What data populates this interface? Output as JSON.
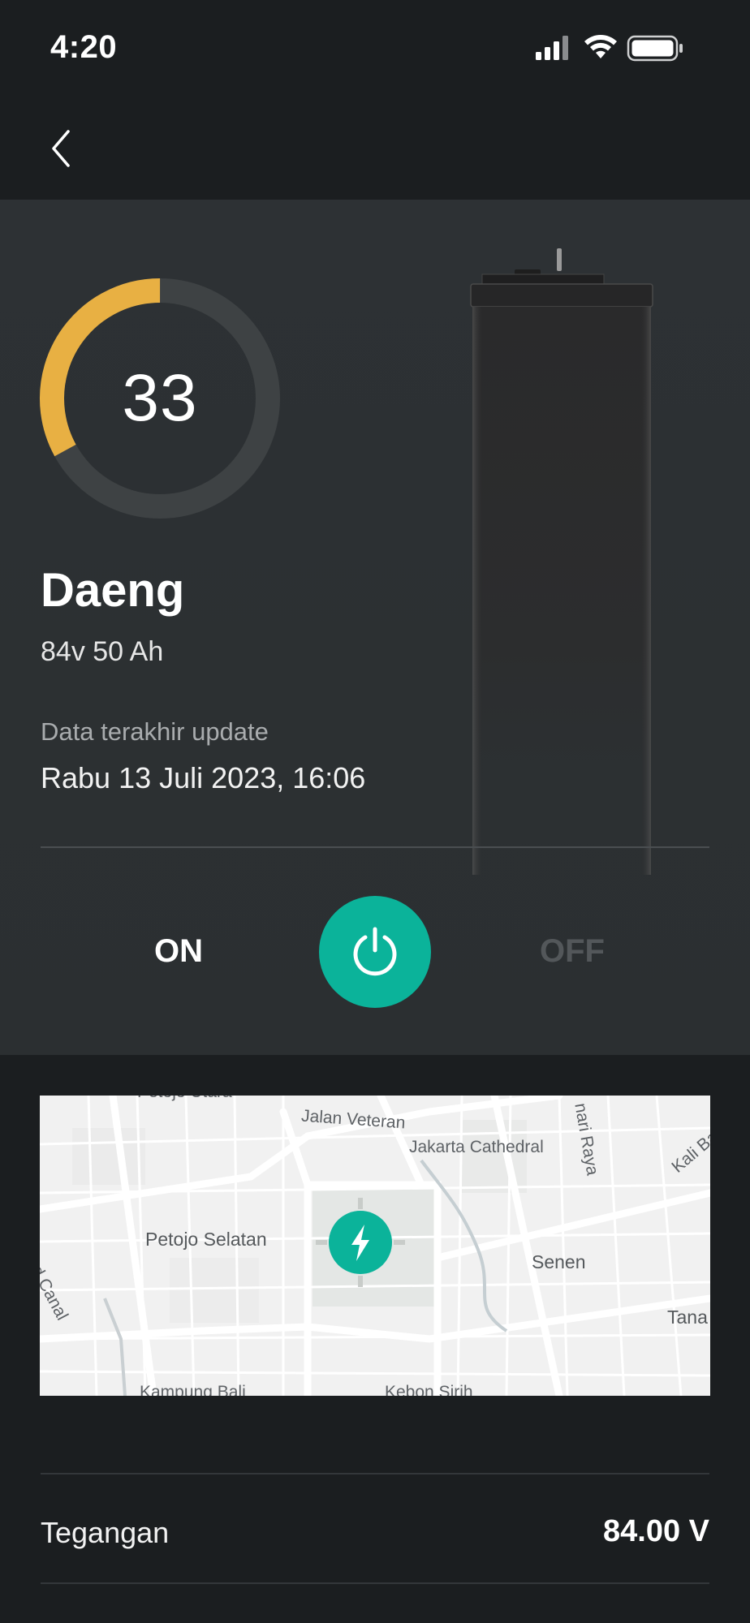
{
  "status_bar": {
    "time": "4:20",
    "icons": [
      "signal-icon",
      "wifi-icon",
      "battery-icon"
    ]
  },
  "nav": {
    "back_icon": "chevron-left-icon"
  },
  "battery": {
    "charge_level": 33,
    "charge_percent": 33,
    "name": "Daeng",
    "spec": "84v 50 Ah",
    "update_label": "Data terakhir update",
    "update_value": "Rabu 13 Juli 2023, 16:06"
  },
  "power": {
    "on_label": "ON",
    "off_label": "OFF",
    "icon": "power-icon",
    "accent": "#0bb39a"
  },
  "map": {
    "labels": [
      "Petojo Utara",
      "Jalan Veteran",
      "Jakarta Cathedral",
      "nari Raya",
      "Kali Baru",
      "Petojo Selatan",
      "Senen",
      "Flood Canal",
      "Tana",
      "Kampung Bali",
      "Kebon Sirih"
    ],
    "marker_icon": "lightning-bolt-icon"
  },
  "stats": {
    "voltage_label": "Tegangan",
    "voltage_value": "84.00 V"
  },
  "colors": {
    "gauge_fill": "#e8b043",
    "gauge_track": "#3e4244",
    "background": "#1b1e20",
    "panel": "#2d3134"
  }
}
